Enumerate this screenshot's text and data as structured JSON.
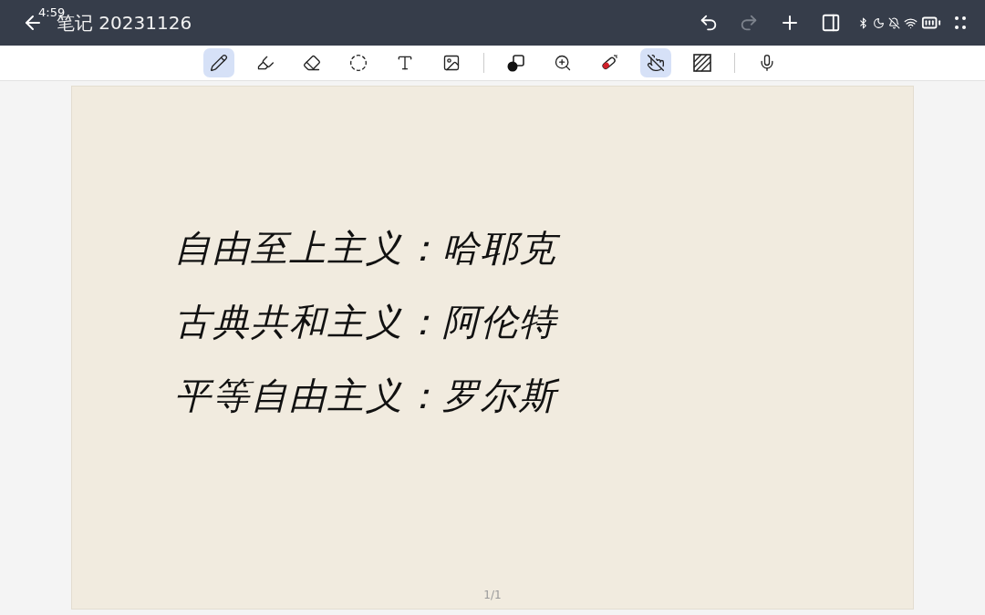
{
  "status_bar": {
    "time": "4:59"
  },
  "header": {
    "title": "笔记 20231126",
    "actions": [
      {
        "kind": "undo",
        "disabled": false
      },
      {
        "kind": "redo",
        "disabled": true
      },
      {
        "kind": "add",
        "disabled": false
      },
      {
        "kind": "layout",
        "disabled": false
      }
    ]
  },
  "toolbar": {
    "groups": [
      [
        {
          "kind": "pen",
          "selected": true
        },
        {
          "kind": "marker",
          "selected": false
        },
        {
          "kind": "eraser",
          "selected": false
        },
        {
          "kind": "lasso",
          "selected": false
        },
        {
          "kind": "text",
          "selected": false
        },
        {
          "kind": "image",
          "selected": false
        }
      ],
      [
        {
          "kind": "color",
          "selected": false
        },
        {
          "kind": "zoom",
          "selected": false
        },
        {
          "kind": "laser",
          "selected": false
        },
        {
          "kind": "touch",
          "selected": true
        },
        {
          "kind": "pattern",
          "selected": false
        }
      ],
      [
        {
          "kind": "mic",
          "selected": false
        }
      ]
    ]
  },
  "page": {
    "handwriting": [
      "自由至上主义：哈耶克",
      "古典共和主义：阿伦特",
      "平等自由主义：罗尔斯"
    ],
    "page_number": "1/1"
  }
}
